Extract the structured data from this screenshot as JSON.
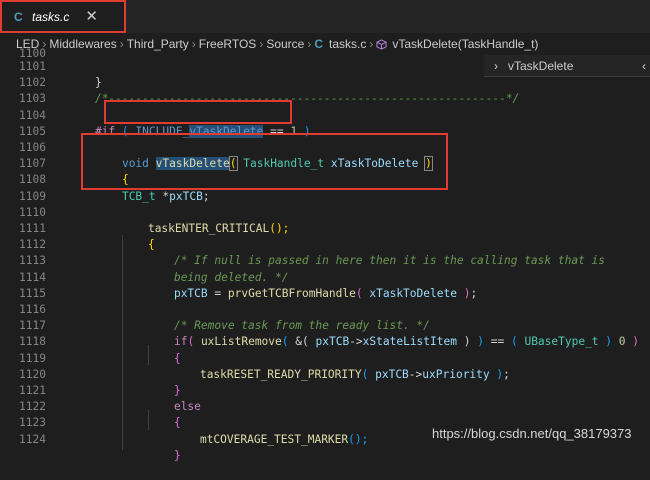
{
  "tab": {
    "icon_label": "C",
    "title": "tasks.c",
    "close_glyph": "✕"
  },
  "breadcrumb": {
    "items": [
      "LED",
      "Middlewares",
      "Third_Party",
      "FreeRTOS",
      "Source"
    ],
    "file_icon_label": "C",
    "file": "tasks.c",
    "symbol": "vTaskDelete(TaskHandle_t)",
    "separator": "›"
  },
  "outline": {
    "chevron": "›",
    "label": "vTaskDelete"
  },
  "line_numbers": [
    "1100",
    "1101",
    "1102",
    "1103",
    "1104",
    "1105",
    "1106",
    "1107",
    "1108",
    "1109",
    "1110",
    "1111",
    "1112",
    "1113",
    "1114",
    "1115",
    "1116",
    "1117",
    "1118",
    "1119",
    "1120",
    "1121",
    "1122",
    "1123",
    "1124"
  ],
  "code": {
    "l1101": "}",
    "l1102": "/*-----------------------------------------------------------*/",
    "l1104": {
      "pp": "#if",
      "open": "(",
      "macro": "INCLUDE_",
      "sym": "vTaskDelete",
      "op": "==",
      "num": "1",
      "close": ")"
    },
    "l1106": {
      "kw": "void",
      "fn": "vTaskDelete",
      "open": "(",
      "type": "TaskHandle_t",
      "param": "xTaskToDelete",
      "close": ")"
    },
    "l1107": "{",
    "l1108": {
      "type": "TCB_t",
      "op": "*",
      "var": "pxTCB",
      "semi": ";"
    },
    "l1110": {
      "fn": "taskENTER_CRITICAL",
      "parens": "();"
    },
    "l1111": "{",
    "l1112": "/* If null is passed in here then it is the calling task that is",
    "l1113": "being deleted. */",
    "l1114": {
      "var": "pxTCB",
      "op": "=",
      "fn": "prvGetTCBFromHandle",
      "open": "(",
      "arg": "xTaskToDelete",
      "close": ")",
      "semi": ";"
    },
    "l1116": "/* Remove task from the ready list. */",
    "l1117": {
      "kw": "if",
      "o1": "(",
      "fn": "uxListRemove",
      "o2": "(",
      "amp": "&(",
      "var": "pxTCB",
      "arrow": "->",
      "member": "xStateListItem",
      "c1": ")",
      "c2": ")",
      "eq": "==",
      "o3": "(",
      "type": "UBaseType_t",
      "c3": ")",
      "num": "0",
      "c4": ")"
    },
    "l1118": "{",
    "l1119": {
      "fn": "taskRESET_READY_PRIORITY",
      "open": "(",
      "var": "pxTCB",
      "arrow": "->",
      "member": "uxPriority",
      "close": ")",
      "semi": ";"
    },
    "l1120": "}",
    "l1121": "else",
    "l1122": "{",
    "l1123": {
      "fn": "mtCOVERAGE_TEST_MARKER",
      "parens": "();"
    },
    "l1124": "}"
  },
  "watermark": "https://blog.csdn.net/qq_38179373",
  "colors": {
    "annotation_box": "#e03c31",
    "editor_bg": "#1e1e1e",
    "keyword": "#569cd6",
    "function": "#dcdcaa",
    "type": "#4ec9b0",
    "variable": "#9cdcfe",
    "comment": "#6a9955",
    "number": "#b5cea8",
    "preprocessor": "#c586c0"
  }
}
